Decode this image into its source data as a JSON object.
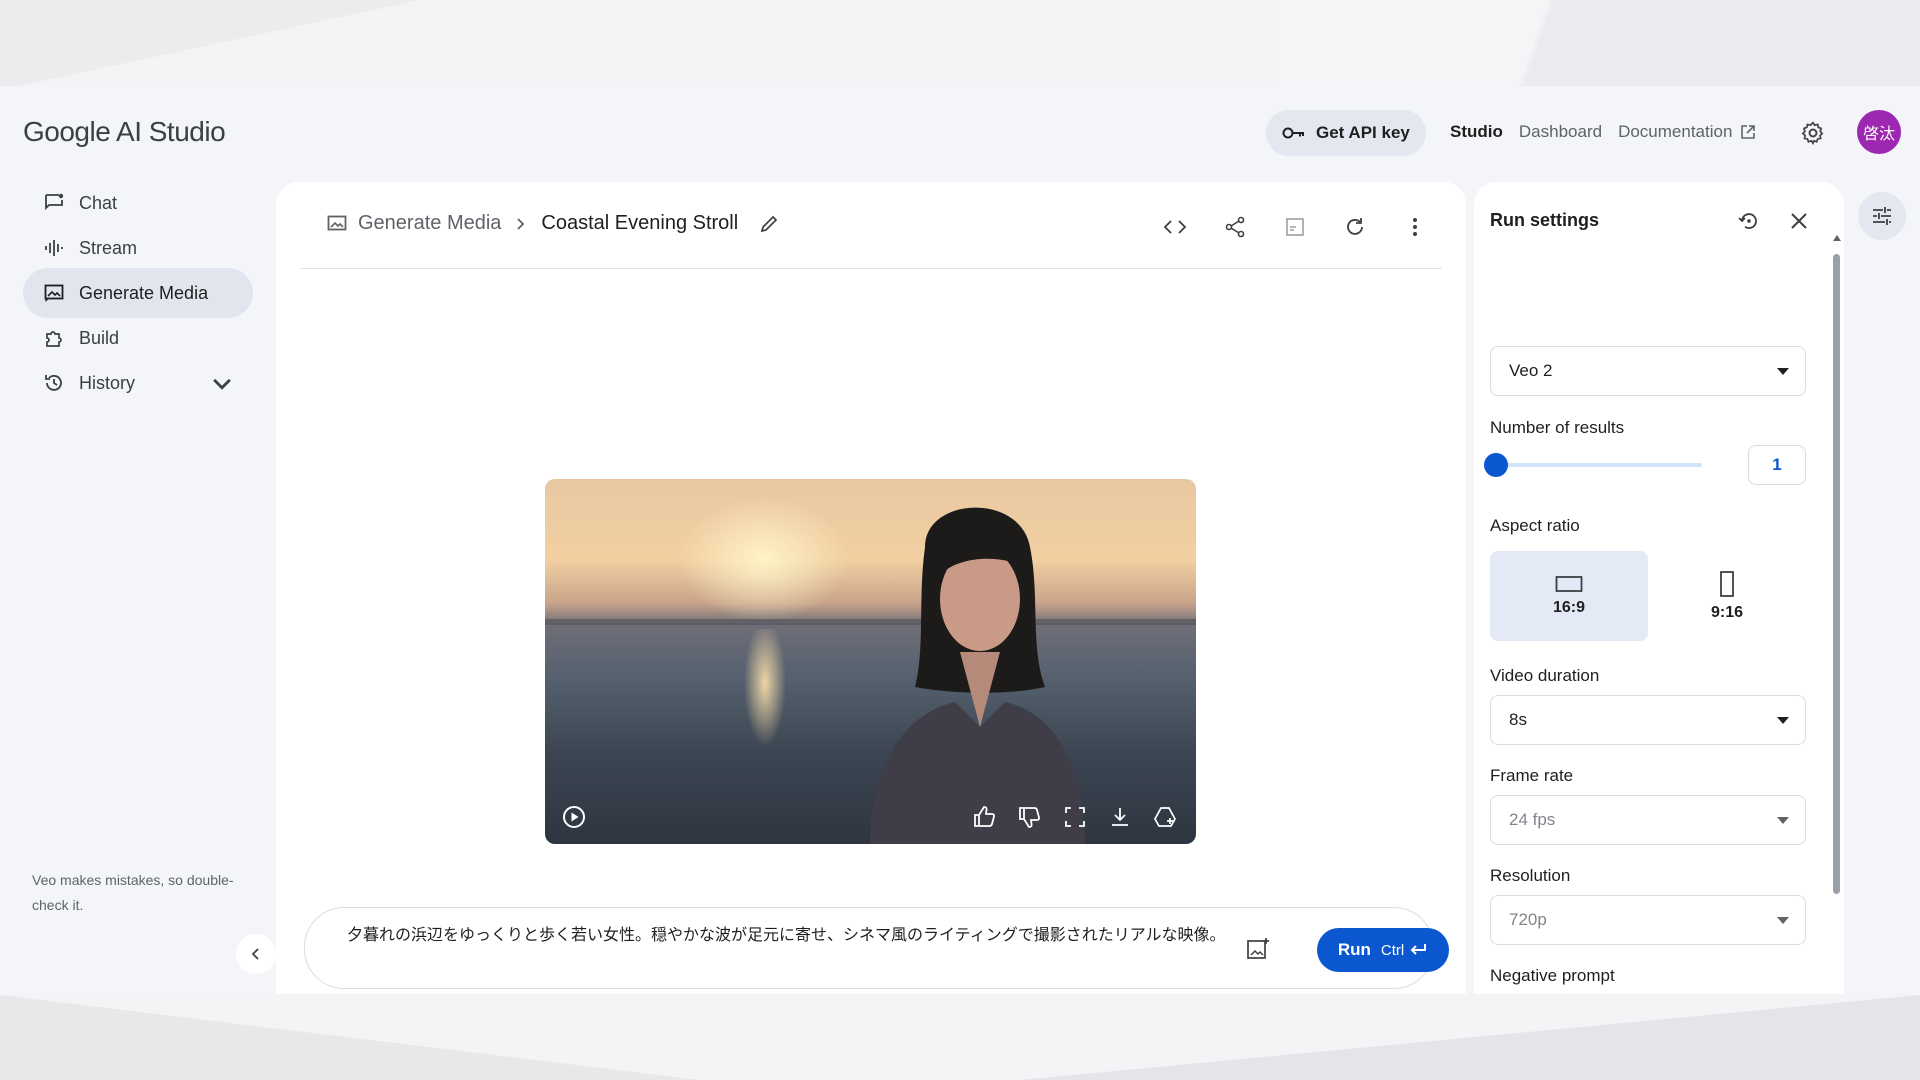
{
  "header": {
    "logo": "Google AI Studio",
    "api_key_label": "Get API key",
    "nav": [
      "Studio",
      "Dashboard",
      "Documentation"
    ],
    "avatar_text": "啓汰"
  },
  "sidebar": {
    "items": [
      {
        "label": "Chat",
        "icon": "chat-icon"
      },
      {
        "label": "Stream",
        "icon": "stream-icon"
      },
      {
        "label": "Generate Media",
        "icon": "media-icon",
        "active": true
      },
      {
        "label": "Build",
        "icon": "build-icon"
      },
      {
        "label": "History",
        "icon": "history-icon"
      }
    ],
    "disclaimer": "Veo makes mistakes, so double-check it."
  },
  "main": {
    "breadcrumb_root": "Generate Media",
    "title": "Coastal Evening Stroll",
    "prompt_text": "夕暮れの浜辺をゆっくりと歩く若い女性。穏やかな波が足元に寄せ、シネマ風のライティングで撮影されたリアルな映像。",
    "run_label": "Run",
    "run_shortcut": "Ctrl"
  },
  "settings": {
    "title": "Run settings",
    "model": "Veo 2",
    "number_of_results_label": "Number of results",
    "number_of_results": "1",
    "aspect_ratio_label": "Aspect ratio",
    "aspect_options": [
      "16:9",
      "9:16"
    ],
    "aspect_selected": "16:9",
    "video_duration_label": "Video duration",
    "video_duration": "8s",
    "frame_rate_label": "Frame rate",
    "frame_rate": "24 fps",
    "resolution_label": "Resolution",
    "resolution": "720p",
    "negative_prompt_label": "Negative prompt"
  },
  "colors": {
    "accent": "#0b57d0",
    "avatar": "#9c27b0",
    "active_nav_bg": "#e1e6ee"
  }
}
